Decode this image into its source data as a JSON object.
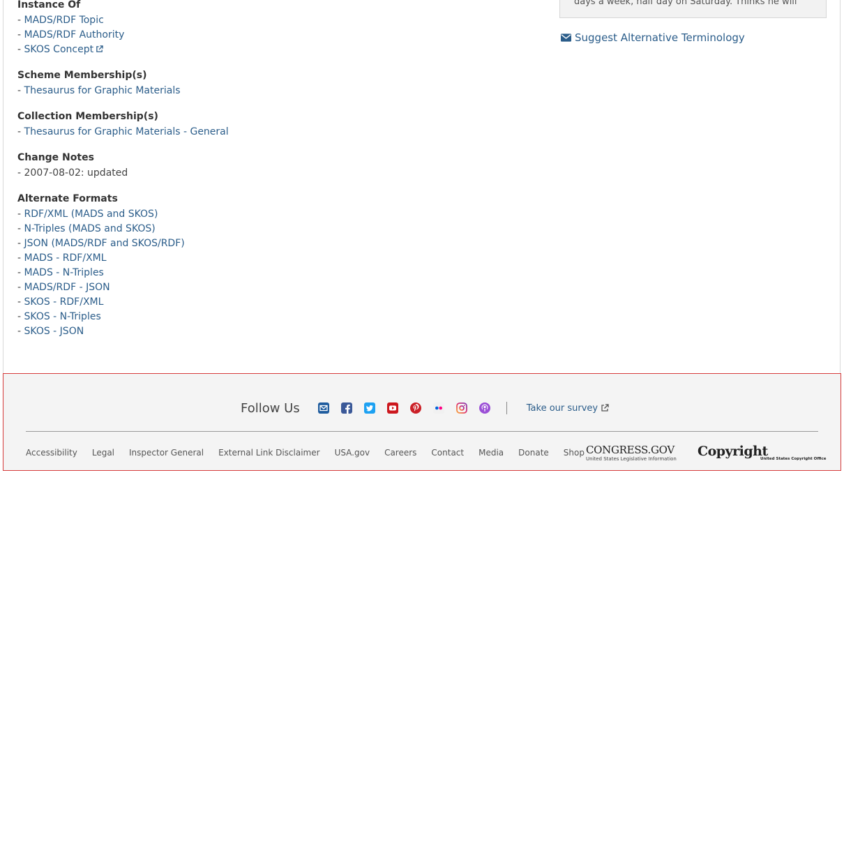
{
  "main": {
    "instance_of": {
      "heading": "Instance Of",
      "items": [
        "MADS/RDF Topic",
        "MADS/RDF Authority",
        "SKOS Concept"
      ]
    },
    "scheme_membership": {
      "heading": "Scheme Membership(s)",
      "items": [
        "Thesaurus for Graphic Materials"
      ]
    },
    "collection_membership": {
      "heading": "Collection Membership(s)",
      "items": [
        "Thesaurus for Graphic Materials - General"
      ]
    },
    "change_notes": {
      "heading": "Change Notes",
      "items": [
        "2007-08-02: updated"
      ]
    },
    "alternate_formats": {
      "heading": "Alternate Formats",
      "items": [
        "RDF/XML (MADS and SKOS)",
        "N-Triples (MADS and SKOS)",
        "JSON (MADS/RDF and SKOS/RDF)",
        "MADS - RDF/XML",
        "MADS - N-Triples",
        "MADS/RDF - JSON",
        "SKOS - RDF/XML",
        "SKOS - N-Triples",
        "SKOS - JSON"
      ]
    },
    "dash": "- "
  },
  "sidebar": {
    "truncated_text": "days a week, half day on Saturday. Thinks he will",
    "suggest_label": "Suggest Alternative Terminology"
  },
  "footer": {
    "follow_label": "Follow Us",
    "social_icons": [
      "email-icon",
      "facebook-icon",
      "twitter-icon",
      "youtube-icon",
      "pinterest-icon",
      "flickr-icon",
      "instagram-icon",
      "podcast-icon"
    ],
    "survey_label": "Take our survey",
    "nav": [
      "Accessibility",
      "Legal",
      "Inspector General",
      "External Link Disclaimer",
      "USA.gov",
      "Careers",
      "Contact",
      "Media",
      "Donate",
      "Shop"
    ],
    "congress_logo": {
      "main": "CONGRESS.GOV",
      "sub": "United States Legislative Information"
    },
    "copyright_logo": {
      "main": "Copyright",
      "sub": "United States Copyright Office"
    }
  },
  "colors": {
    "link": "#2b5d8a",
    "footer_bg": "#f4f4f4",
    "footer_border": "#d63b3b"
  }
}
